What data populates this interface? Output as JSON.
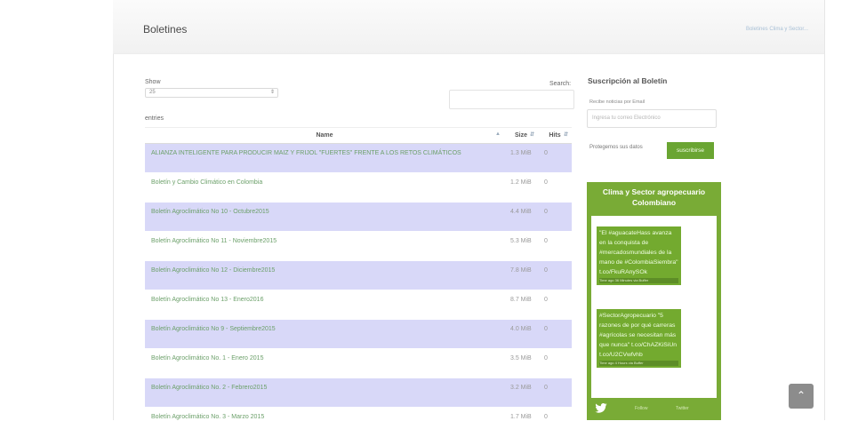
{
  "header": {
    "title": "Boletines",
    "breadcrumb": "Boletines Clima y Sector..."
  },
  "table_controls": {
    "show_label": "Show",
    "show_value": "25",
    "entries_label": "entries",
    "search_label": "Search:"
  },
  "table": {
    "columns": [
      "Name",
      "Size",
      "Hits"
    ],
    "rows": [
      {
        "name": "ALIANZA INTELIGENTE PARA PRODUCIR MAIZ Y FRIJOL \"FUERTES\" FRENTE A LOS RETOS CLIMÁTICOS",
        "size": "1.3 MiB",
        "hits": "0"
      },
      {
        "name": "Boletín y Cambio Climático en Colombia",
        "size": "1.2 MiB",
        "hits": "0"
      },
      {
        "name": "Boletín Agroclimático No 10 - Octubre2015",
        "size": "4.4 MiB",
        "hits": "0"
      },
      {
        "name": "Boletín Agroclimático No 11 - Noviembre2015",
        "size": "5.3 MiB",
        "hits": "0"
      },
      {
        "name": "Boletín Agroclimático No 12 - Diciembre2015",
        "size": "7.8 MiB",
        "hits": "0"
      },
      {
        "name": "Boletín Agroclimático No 13 - Enero2016",
        "size": "8.7 MiB",
        "hits": "0"
      },
      {
        "name": "Boletín Agroclimático No 9 - Septiembre2015",
        "size": "4.0 MiB",
        "hits": "0"
      },
      {
        "name": "Boletín Agroclimático No. 1 - Enero 2015",
        "size": "3.5 MiB",
        "hits": "0"
      },
      {
        "name": "Boletín Agroclimático No. 2 - Febrero2015",
        "size": "3.2 MiB",
        "hits": "0"
      },
      {
        "name": "Boletín Agroclimático No. 3 - Marzo 2015",
        "size": "1.7 MiB",
        "hits": "0"
      }
    ]
  },
  "subscription": {
    "title": "Suscripción al Boletín",
    "email_label": "Recibe noticias por Email",
    "email_placeholder": "Ingresa tu correo Electrónico",
    "protect_label": "Protegemos sus datos",
    "subscribe_label": "suscribirse"
  },
  "twitter_widget": {
    "title": "Clima y Sector agropecuario Colombiano",
    "tweets": [
      {
        "text": "\"El #aguacateHass avanza en la conquista de #mercadosmundiales de la mano de #ColombiaSiembra\" t.co/FkuRAnySOk",
        "meta": "Time ago 36 Minutes via Buffer"
      },
      {
        "text": "#SectorAgropecuario \"5 razones de por qué carreras #agrícolas se necesitan más que nunca\" t.co/ChAZKiSiUn t.co/U2CVwfvhb",
        "meta": "Time ago 4 Hours via Buffer"
      }
    ],
    "follow_left": "Follow",
    "follow_right": "Twitter"
  },
  "colors": {
    "accent_green": "#79ab36",
    "row_stripe": "#d8d8f8",
    "link_green": "#6ca06a"
  }
}
